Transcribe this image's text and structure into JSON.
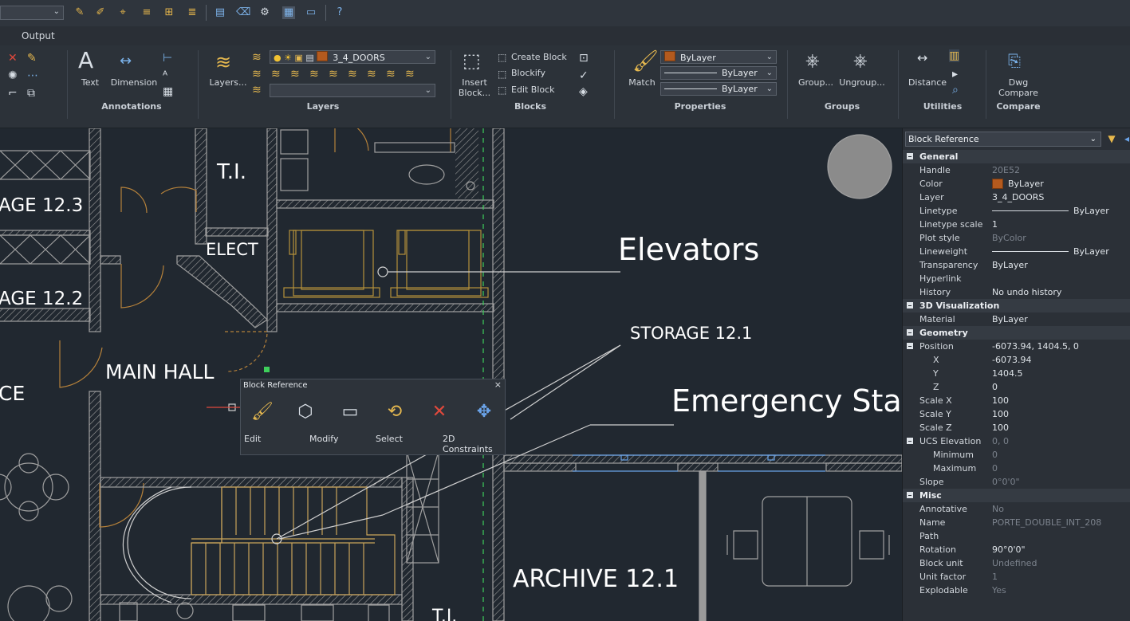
{
  "tab": {
    "label": "Output"
  },
  "ribbon": {
    "panels": [
      "Annotations",
      "Layers",
      "Blocks",
      "Properties",
      "Groups",
      "Utilities",
      "Compare"
    ],
    "annotations": {
      "text": "Text",
      "dimension": "Dimension"
    },
    "layers": {
      "layers_btn": "Layers...",
      "current_layer": "3_4_DOORS"
    },
    "blocks": {
      "insert": "Insert",
      "block": "Block...",
      "create_block": "Create Block",
      "blockify": "Blockify",
      "edit_block": "Edit Block"
    },
    "properties": {
      "match": "Match",
      "color": "ByLayer",
      "linetype": "ByLayer",
      "lineweight": "ByLayer"
    },
    "groups": {
      "group": "Group...",
      "ungroup": "Ungroup..."
    },
    "utilities": {
      "distance": "Distance"
    },
    "compare": {
      "dwg": "Dwg",
      "compare": "Compare"
    }
  },
  "drawing": {
    "labels": {
      "ti_top": "T.I.",
      "storage_123": "AGE 12.3",
      "storage_122": "AGE 12.2",
      "elect": "ELECT",
      "elevators": "Elevators",
      "storage_121": "STORAGE 12.1",
      "main_hall": "MAIN HALL",
      "ce": "CE",
      "emergency": "Emergency Sta",
      "archive": "ARCHIVE 12.1",
      "ti_bottom": "T.I."
    }
  },
  "quad": {
    "title": "Block Reference",
    "close": "×",
    "labels": {
      "edit": "Edit",
      "modify": "Modify",
      "select": "Select",
      "constraints": "2D Constraints"
    }
  },
  "properties_panel": {
    "selector": "Block Reference",
    "sections": {
      "general": "General",
      "visualization": "3D Visualization",
      "geometry": "Geometry",
      "misc": "Misc"
    },
    "rows": {
      "handle": {
        "k": "Handle",
        "v": "20E52"
      },
      "color": {
        "k": "Color",
        "v": "ByLayer"
      },
      "layer": {
        "k": "Layer",
        "v": "3_4_DOORS"
      },
      "linetype": {
        "k": "Linetype",
        "v": "ByLayer"
      },
      "linetype_scale": {
        "k": "Linetype scale",
        "v": "1"
      },
      "plot_style": {
        "k": "Plot style",
        "v": "ByColor"
      },
      "lineweight": {
        "k": "Lineweight",
        "v": "ByLayer"
      },
      "transparency": {
        "k": "Transparency",
        "v": "ByLayer"
      },
      "hyperlink": {
        "k": "Hyperlink",
        "v": ""
      },
      "history": {
        "k": "History",
        "v": "No undo history"
      },
      "material": {
        "k": "Material",
        "v": "ByLayer"
      },
      "position": {
        "k": "Position",
        "v": "-6073.94, 1404.5, 0"
      },
      "x": {
        "k": "X",
        "v": "-6073.94"
      },
      "y": {
        "k": "Y",
        "v": "1404.5"
      },
      "z": {
        "k": "Z",
        "v": "0"
      },
      "scale_x": {
        "k": "Scale X",
        "v": "100"
      },
      "scale_y": {
        "k": "Scale Y",
        "v": "100"
      },
      "scale_z": {
        "k": "Scale Z",
        "v": "100"
      },
      "ucs_elev": {
        "k": "UCS Elevation",
        "v": "0, 0"
      },
      "minimum": {
        "k": "Minimum",
        "v": "0"
      },
      "maximum": {
        "k": "Maximum",
        "v": "0"
      },
      "slope": {
        "k": "Slope",
        "v": "0°0'0\""
      },
      "annotative": {
        "k": "Annotative",
        "v": "No"
      },
      "name": {
        "k": "Name",
        "v": "PORTE_DOUBLE_INT_208"
      },
      "path": {
        "k": "Path",
        "v": ""
      },
      "rotation": {
        "k": "Rotation",
        "v": "90°0'0\""
      },
      "block_unit": {
        "k": "Block unit",
        "v": "Undefined"
      },
      "unit_factor": {
        "k": "Unit factor",
        "v": "1"
      },
      "explodable": {
        "k": "Explodable",
        "v": "Yes"
      }
    }
  },
  "colors": {
    "canvas": "#212830",
    "wall": "#9a9a9a",
    "door": "#b5813a",
    "fixture": "#c9a45a",
    "accent_green": "#3ecf5b"
  }
}
